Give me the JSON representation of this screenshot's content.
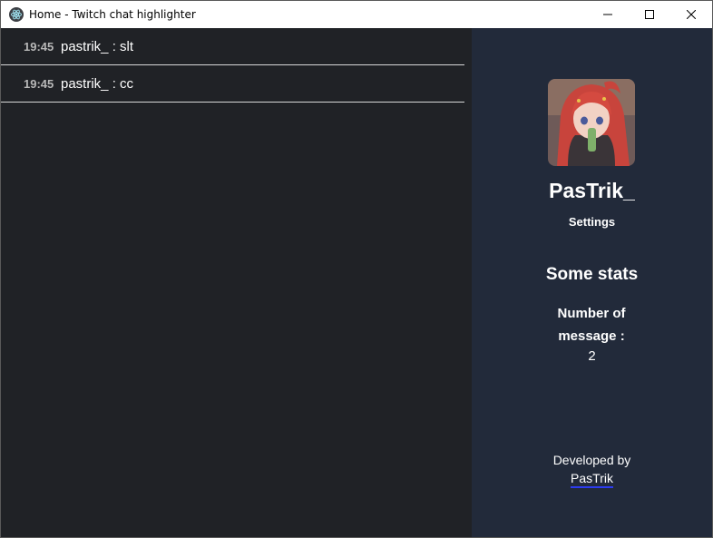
{
  "window": {
    "title": "Home - Twitch chat highlighter",
    "app_icon": "electron-icon",
    "controls": [
      "minimize-icon",
      "maximize-icon",
      "close-icon"
    ]
  },
  "chat": {
    "messages": [
      {
        "time": "19:45",
        "text": "pastrik_ : slt"
      },
      {
        "time": "19:45",
        "text": "pastrik_ : cc"
      }
    ]
  },
  "sidebar": {
    "avatar": "avatar-image",
    "username": "PasTrik_",
    "settings_label": "Settings",
    "stats_title": "Some stats",
    "message_count_label": "Number of message :",
    "message_count_value": "2",
    "developed_by_label": "Developed by",
    "developer_link": "PasTrik"
  },
  "colors": {
    "chat_background": "#202226",
    "sidebar_background": "#222a3a",
    "link_underline": "#2d3cf0"
  }
}
